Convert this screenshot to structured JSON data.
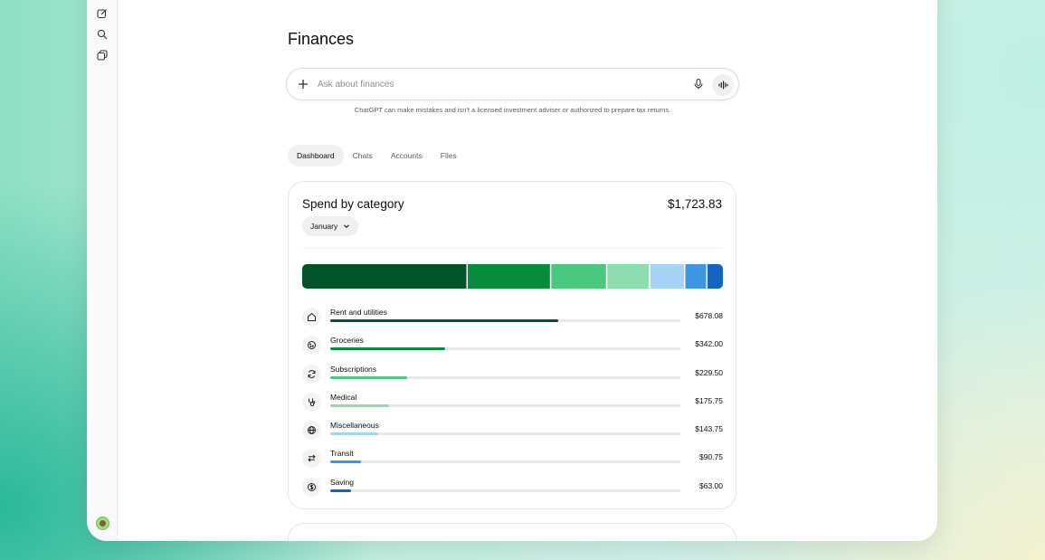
{
  "page": {
    "title": "Finances"
  },
  "rail": {
    "icons": [
      "new-chat-icon",
      "search-icon",
      "library-icon"
    ]
  },
  "composer": {
    "placeholder": "Ask about finances",
    "disclaimer": "ChatGPT can make mistakes and isn't a licensed investment adviser or authorized to prepare tax returns."
  },
  "tabs": [
    {
      "label": "Dashboard",
      "active": true
    },
    {
      "label": "Chats",
      "active": false
    },
    {
      "label": "Accounts",
      "active": false
    },
    {
      "label": "Files",
      "active": false
    }
  ],
  "spend_card": {
    "title": "Spend by category",
    "total": "$1,723.83",
    "month": "January",
    "categories": [
      {
        "label": "Rent and utilities",
        "amount": "$678.08",
        "value": 678.08,
        "color": "#02532a",
        "icon": "home-icon"
      },
      {
        "label": "Groceries",
        "amount": "$342.00",
        "value": 342.0,
        "color": "#068c3c",
        "icon": "cookie-icon"
      },
      {
        "label": "Subscriptions",
        "amount": "$229.50",
        "value": 229.5,
        "color": "#4bc880",
        "icon": "refresh-icon"
      },
      {
        "label": "Medical",
        "amount": "$175.75",
        "value": 175.75,
        "color": "#8dddb1",
        "icon": "stethoscope-icon"
      },
      {
        "label": "Miscellaneous",
        "amount": "$143.75",
        "value": 143.75,
        "color": "#a8d3f7",
        "icon": "globe-icon"
      },
      {
        "label": "Transit",
        "amount": "$90.75",
        "value": 90.75,
        "color": "#3e95e4",
        "icon": "transfer-arrows-icon"
      },
      {
        "label": "Saving",
        "amount": "$63.00",
        "value": 63.0,
        "color": "#1565c0",
        "icon": "dollar-circle-icon"
      }
    ]
  }
}
